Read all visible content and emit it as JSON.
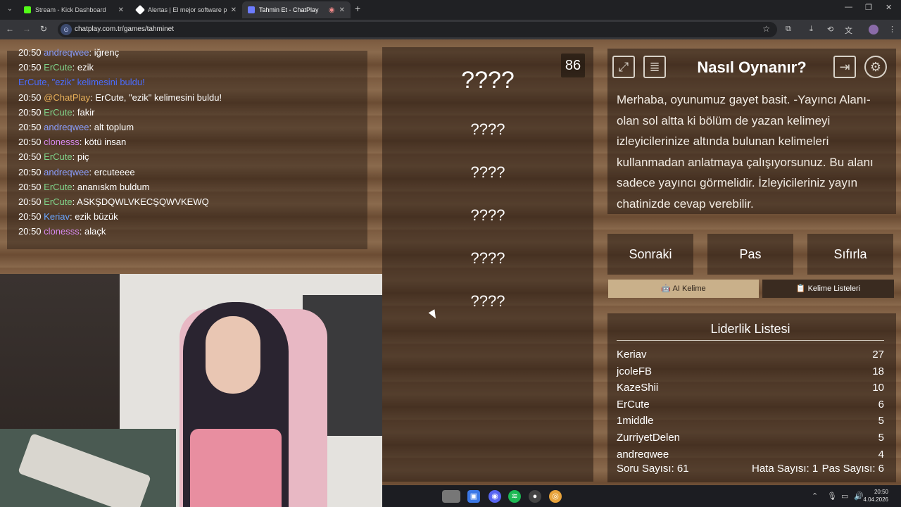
{
  "browser": {
    "tabs": [
      {
        "title": "Stream - Kick Dashboard",
        "favicon_color": "#53fc18"
      },
      {
        "title": "Alertas | El mejor software para",
        "favicon_color": "#ffffff"
      },
      {
        "title": "Tahmin Et - ChatPlay",
        "favicon_color": "#6d7cff"
      }
    ],
    "active_tab": 2,
    "url": "chatplay.com.tr/games/tahminet"
  },
  "chat": {
    "messages": [
      {
        "time": "20:50",
        "user": "andreqwee",
        "user_color": "#8a9eff",
        "text": ": iğrenç"
      },
      {
        "time": "20:50",
        "user": "ErCute",
        "user_color": "#7fd38a",
        "text": ": ezik"
      },
      {
        "time": "",
        "user": "",
        "user_color": "#4a6cff",
        "text": "ErCute, \"ezik\" kelimesini buldu!"
      },
      {
        "time": "20:50",
        "user": "@ChatPlay",
        "user_color": "#e8b05a",
        "text": ": ErCute, \"ezik\" kelimesini buldu!"
      },
      {
        "time": "20:50",
        "user": "ErCute",
        "user_color": "#7fd38a",
        "text": ": fakir"
      },
      {
        "time": "20:50",
        "user": "andreqwee",
        "user_color": "#8a9eff",
        "text": ": alt toplum"
      },
      {
        "time": "20:50",
        "user": "clonesss",
        "user_color": "#d88af0",
        "text": ": kötü insan"
      },
      {
        "time": "20:50",
        "user": "ErCute",
        "user_color": "#7fd38a",
        "text": ": piç"
      },
      {
        "time": "20:50",
        "user": "andreqwee",
        "user_color": "#8a9eff",
        "text": ": ercuteeee"
      },
      {
        "time": "20:50",
        "user": "ErCute",
        "user_color": "#7fd38a",
        "text": ": ananıskm buldum"
      },
      {
        "time": "20:50",
        "user": "ErCute",
        "user_color": "#7fd38a",
        "text": ": ASKŞDQWLVKECŞQWVKEWQ"
      },
      {
        "time": "20:50",
        "user": "Keriav",
        "user_color": "#6aa6ff",
        "text": ": ezik büzük"
      },
      {
        "time": "20:50",
        "user": "clonesss",
        "user_color": "#d88af0",
        "text": ": alaçk"
      }
    ]
  },
  "game": {
    "counter": "86",
    "words": [
      "????",
      "????",
      "????",
      "????",
      "????",
      "????"
    ]
  },
  "howto": {
    "title": "Nasıl Oynanır?",
    "body": "Merhaba, oyunumuz gayet basit. -Yayıncı Alanı- olan sol altta ki bölüm de yazan kelimeyi izleyicilerinize altında bulunan kelimeleri kullanmadan anlatmaya çalışıyorsunuz. Bu alanı sadece yayıncı görmelidir. İzleyicileriniz yayın chatinizde cevap verebilir."
  },
  "actions": {
    "next": "Sonraki",
    "pass": "Pas",
    "reset": "Sıfırla",
    "ai_word": "AI Kelime",
    "word_lists": "Kelime Listeleri"
  },
  "leaderboard": {
    "title": "Liderlik Listesi",
    "rows": [
      {
        "name": "Keriav",
        "score": "27"
      },
      {
        "name": "jcoleFB",
        "score": "18"
      },
      {
        "name": "KazeShii",
        "score": "10"
      },
      {
        "name": "ErCute",
        "score": "6"
      },
      {
        "name": "1middle",
        "score": "5"
      },
      {
        "name": "ZurriyetDelen",
        "score": "5"
      },
      {
        "name": "andreqwee",
        "score": "4"
      }
    ],
    "question_count": "Soru Sayısı: 61",
    "error_count": "Hata Sayısı: 1",
    "pass_count": "Pas Sayısı: 6"
  },
  "taskbar": {
    "time": "20:50",
    "date": "4.04.2026"
  }
}
